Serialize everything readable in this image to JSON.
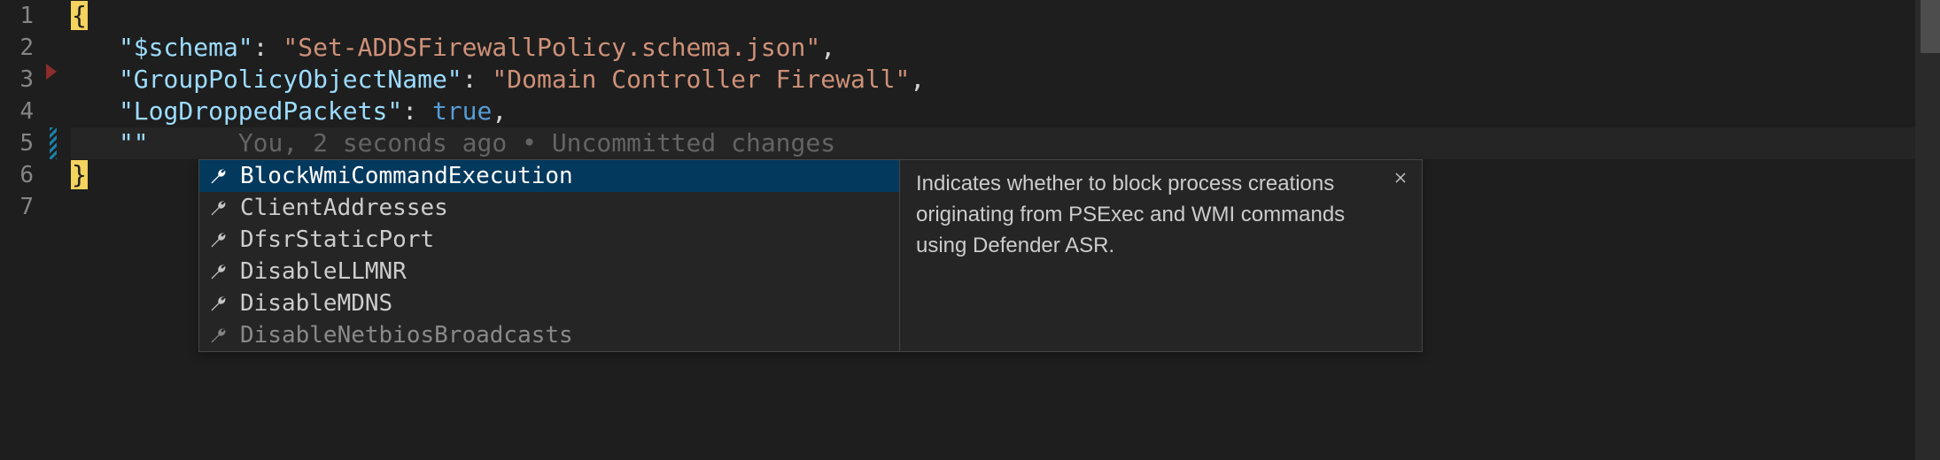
{
  "gutter": {
    "lines": [
      "1",
      "2",
      "3",
      "4",
      "5",
      "6",
      "7"
    ]
  },
  "code": {
    "l1_brace": "{",
    "l2_key": "\"$schema\"",
    "l2_colon": ": ",
    "l2_val": "\"Set-ADDSFirewallPolicy.schema.json\"",
    "l2_comma": ",",
    "l3_key": "\"GroupPolicyObjectName\"",
    "l3_colon": ": ",
    "l3_val": "\"Domain Controller Firewall\"",
    "l3_comma": ",",
    "l4_key": "\"LogDroppedPackets\"",
    "l4_colon": ": ",
    "l4_val": "true",
    "l4_comma": ",",
    "l5_key": "\"\"",
    "l5_codelens": "You, 2 seconds ago • Uncommitted changes",
    "l6_brace": "}"
  },
  "suggest": {
    "items": [
      {
        "label": "BlockWmiCommandExecution",
        "selected": true
      },
      {
        "label": "ClientAddresses",
        "selected": false
      },
      {
        "label": "DfsrStaticPort",
        "selected": false
      },
      {
        "label": "DisableLLMNR",
        "selected": false
      },
      {
        "label": "DisableMDNS",
        "selected": false
      },
      {
        "label": "DisableNetbiosBroadcasts",
        "selected": false,
        "partial": true
      }
    ],
    "doc": "Indicates whether to block process creations originating from PSExec and WMI commands using Defender ASR."
  }
}
